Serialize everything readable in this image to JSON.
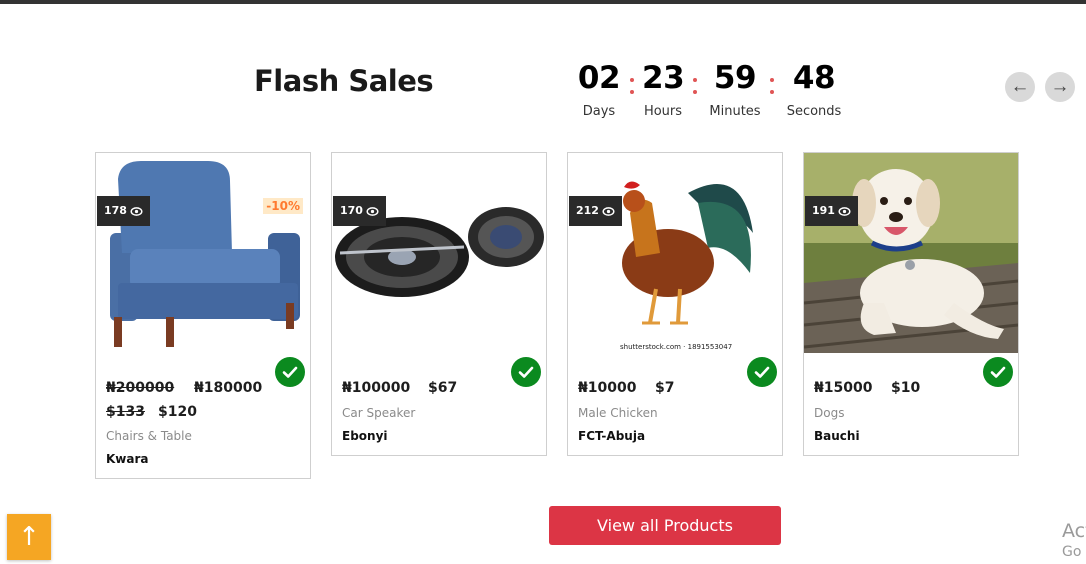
{
  "section": {
    "title": "Flash Sales"
  },
  "countdown": [
    {
      "value": "02",
      "label": "Days"
    },
    {
      "value": "23",
      "label": "Hours"
    },
    {
      "value": "59",
      "label": "Minutes"
    },
    {
      "value": "48",
      "label": "Seconds"
    }
  ],
  "nav": {
    "prev_icon": "arrow-left-icon",
    "next_icon": "arrow-right-icon"
  },
  "products": [
    {
      "views": "178",
      "discount": "-10%",
      "price_naira_old": "₦200000",
      "price_naira": "₦180000",
      "price_usd_old": "$133",
      "price_usd": "$120",
      "category": "Chairs & Table",
      "location": "Kwara"
    },
    {
      "views": "170",
      "price_naira": "₦100000",
      "price_usd": "$67",
      "category": "Car Speaker",
      "location": "Ebonyi"
    },
    {
      "views": "212",
      "price_naira": "₦10000",
      "price_usd": "$7",
      "category": "Male Chicken",
      "location": "FCT-Abuja",
      "watermark": "shutterstock.com · 1891553047"
    },
    {
      "views": "191",
      "price_naira": "₦15000",
      "price_usd": "$10",
      "category": "Dogs",
      "location": "Bauchi"
    }
  ],
  "view_all_label": "View all Products",
  "scroll_top_icon": "↑",
  "activate": {
    "line1": "Act",
    "line2": "Go t"
  },
  "colors": {
    "accent": "#dc3545",
    "check": "#0b8a1f",
    "badge": "#2a2a2a",
    "discount": "#ff7a2f",
    "scroll_top": "#f5a623",
    "colon": "#e05555"
  }
}
